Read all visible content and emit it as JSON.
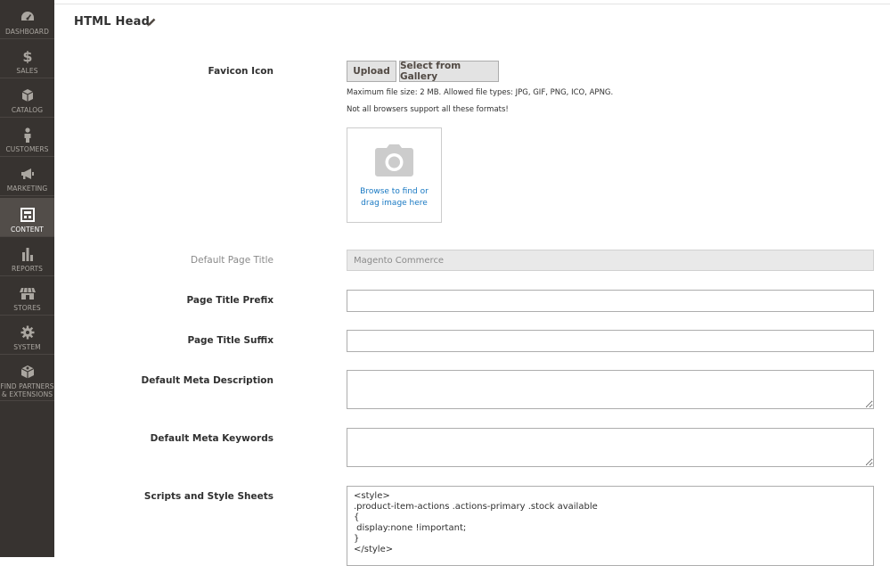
{
  "sidebar": {
    "items": [
      {
        "id": "dashboard",
        "label": "Dashboard",
        "icon": "dashboard-icon"
      },
      {
        "id": "sales",
        "label": "Sales",
        "icon": "dollar-icon"
      },
      {
        "id": "catalog",
        "label": "Catalog",
        "icon": "box-icon"
      },
      {
        "id": "customers",
        "label": "Customers",
        "icon": "person-icon"
      },
      {
        "id": "marketing",
        "label": "Marketing",
        "icon": "megaphone-icon"
      },
      {
        "id": "content",
        "label": "Content",
        "icon": "layout-icon",
        "active": true
      },
      {
        "id": "reports",
        "label": "Reports",
        "icon": "bar-chart-icon"
      },
      {
        "id": "stores",
        "label": "Stores",
        "icon": "store-icon"
      },
      {
        "id": "system",
        "label": "System",
        "icon": "gear-icon"
      },
      {
        "id": "partners",
        "label": "Find Partners & Extensions",
        "icon": "puzzle-box-icon"
      }
    ]
  },
  "section": {
    "title": "HTML Head"
  },
  "favicon": {
    "label": "Favicon Icon",
    "upload_label": "Upload",
    "gallery_label": "Select from Gallery",
    "note_size": "Maximum file size: 2 MB. Allowed file types: JPG, GIF, PNG, ICO, APNG.",
    "note_browsers": "Not all browsers support all these formats!",
    "dropzone_line1": "Browse to find or",
    "dropzone_line2": "drag image here"
  },
  "fields": {
    "default_title": {
      "label": "Default Page Title",
      "value": "Magento Commerce"
    },
    "title_prefix": {
      "label": "Page Title Prefix",
      "value": ""
    },
    "title_suffix": {
      "label": "Page Title Suffix",
      "value": ""
    },
    "meta_description": {
      "label": "Default Meta Description",
      "value": ""
    },
    "meta_keywords": {
      "label": "Default Meta Keywords",
      "value": ""
    },
    "scripts": {
      "label": "Scripts and Style Sheets",
      "value": "<style>\n.product-item-actions .actions-primary .stock available\n{\n display:none !important;\n}\n</style>"
    }
  },
  "colors": {
    "sidebar_bg": "#373330",
    "sidebar_active": "#524d49",
    "link": "#1979c3"
  }
}
